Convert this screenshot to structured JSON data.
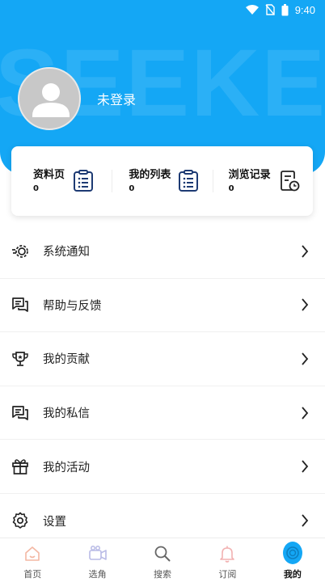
{
  "header": {
    "watermark": "SEEKER",
    "login_text": "未登录",
    "bg_color": "#14a7f5"
  },
  "status_bar": {
    "time": "9:40",
    "icons": [
      "wifi-icon",
      "no-sim-icon",
      "battery-icon"
    ]
  },
  "stats": [
    {
      "label": "资料页",
      "value": "0",
      "icon": "document-list-icon"
    },
    {
      "label": "我的列表",
      "value": "0",
      "icon": "clipboard-list-icon"
    },
    {
      "label": "浏览记录",
      "value": "0",
      "icon": "history-file-icon"
    }
  ],
  "menu": [
    {
      "label": "系统通知",
      "icon": "notification-gear-icon"
    },
    {
      "label": "帮助与反馈",
      "icon": "feedback-chat-icon"
    },
    {
      "label": "我的贡献",
      "icon": "trophy-icon"
    },
    {
      "label": "我的私信",
      "icon": "message-icon"
    },
    {
      "label": "我的活动",
      "icon": "gift-icon"
    },
    {
      "label": "设置",
      "icon": "settings-gear-icon"
    }
  ],
  "bottom_nav": [
    {
      "label": "首页",
      "icon": "home-icon"
    },
    {
      "label": "选角",
      "icon": "camera-icon"
    },
    {
      "label": "搜索",
      "icon": "search-icon"
    },
    {
      "label": "订阅",
      "icon": "bell-icon"
    },
    {
      "label": "我的",
      "icon": "profile-icon",
      "active": true
    }
  ]
}
